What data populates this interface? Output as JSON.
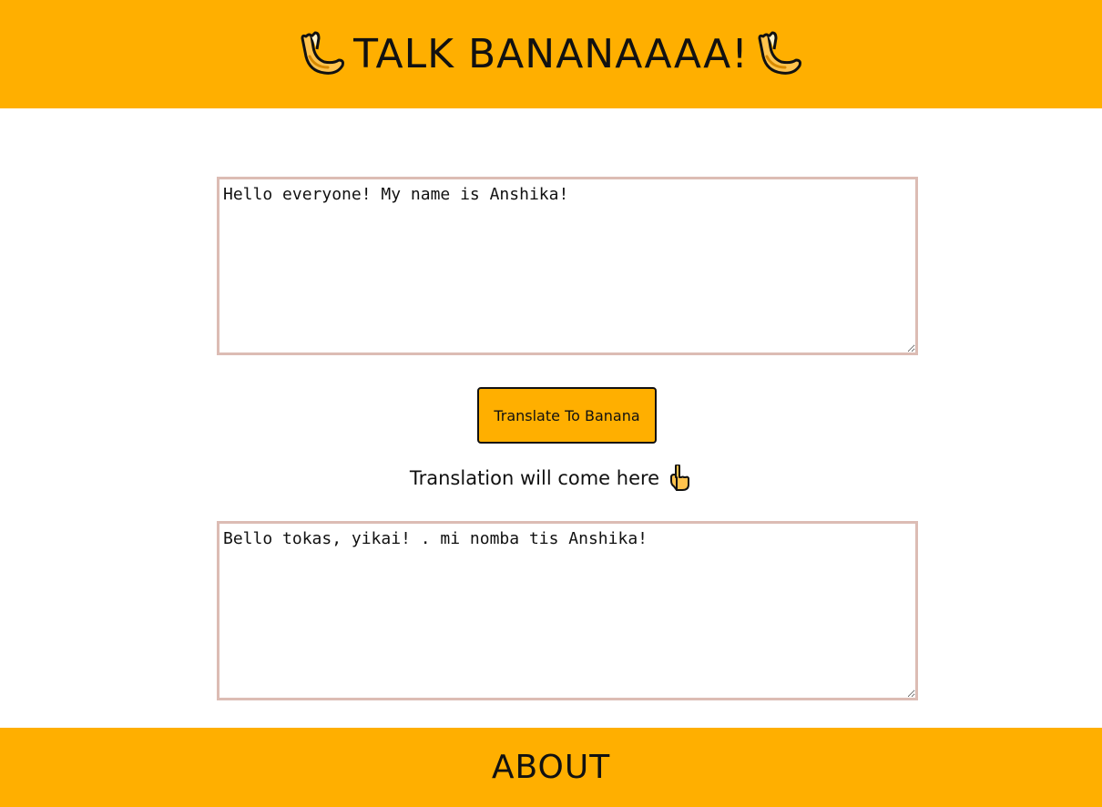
{
  "header": {
    "title": "TALK BANANAAAA!",
    "left_icon": "banana-icon",
    "right_icon": "banana-icon"
  },
  "input": {
    "value": "Hello everyone! My name is Anshika!"
  },
  "translate_button": {
    "label": "Translate To Banana"
  },
  "hint": {
    "text": "Translation will come here",
    "icon": "pointing-down-icon"
  },
  "output": {
    "value": "Bello tokas, yikai! . mi nomba tis Anshika!"
  },
  "footer": {
    "link_label": "ABOUT"
  },
  "colors": {
    "accent": "#ffaf00",
    "textarea_border": "#dcbcb4",
    "text": "#111111"
  }
}
